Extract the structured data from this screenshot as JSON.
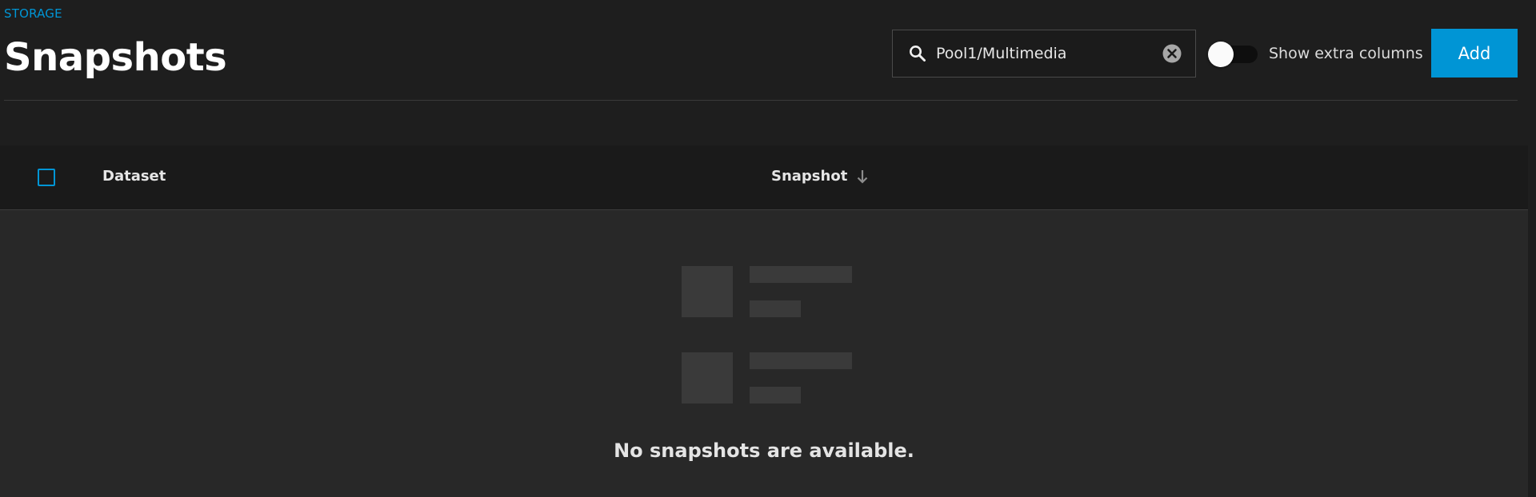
{
  "header": {
    "breadcrumb": "STORAGE",
    "title": "Snapshots"
  },
  "search": {
    "value": "Pool1/Multimedia",
    "placeholder": "Search",
    "icon": "search-icon",
    "clear_icon": "clear-icon"
  },
  "toggle": {
    "label": "Show extra columns",
    "checked": false
  },
  "toolbar": {
    "add_label": "Add"
  },
  "table": {
    "columns": [
      "Dataset",
      "Snapshot"
    ],
    "sort_column": "Snapshot",
    "sort_direction": "descending",
    "empty_message": "No snapshots are available."
  },
  "colors": {
    "accent": "#0095d5",
    "background": "#1e1e1e",
    "table_body": "#282828"
  }
}
